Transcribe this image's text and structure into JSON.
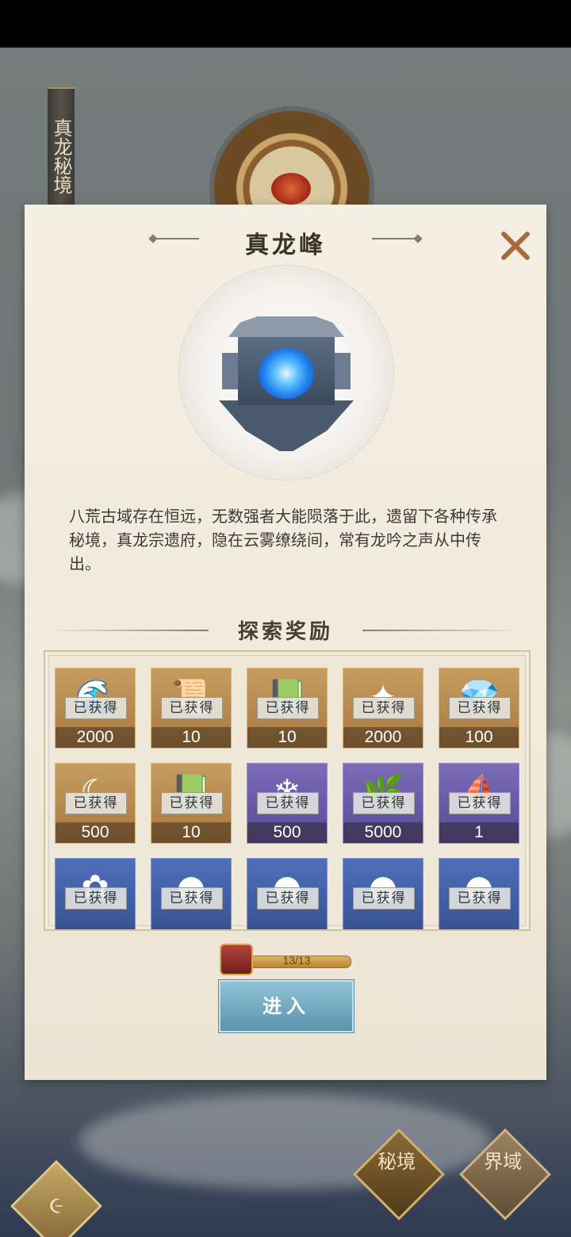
{
  "background": {
    "vertical_title": "真龙秘境"
  },
  "panel": {
    "title": "真龙峰",
    "description": "八荒古域存在恒远，无数强者大能陨落于此，遗留下各种传承秘境，真龙宗遗府，隐在云雾缭绕间，常有龙吟之声从中传出。",
    "rewards_heading": "探索奖励",
    "obtained_label": "已获得",
    "rewards": [
      {
        "icon": "blue-wave-icon",
        "glyph": "🌊",
        "qty": "2000",
        "tier": "gold"
      },
      {
        "icon": "scroll-icon",
        "glyph": "📜",
        "qty": "10",
        "tier": "gold"
      },
      {
        "icon": "book-icon",
        "glyph": "📗",
        "qty": "10",
        "tier": "gold"
      },
      {
        "icon": "gold-star-icon",
        "glyph": "✦",
        "qty": "2000",
        "tier": "gold"
      },
      {
        "icon": "crystal-orb-icon",
        "glyph": "💎",
        "qty": "100",
        "tier": "gold"
      },
      {
        "icon": "moon-crescent-icon",
        "glyph": "☾",
        "qty": "500",
        "tier": "gold"
      },
      {
        "icon": "book-icon",
        "glyph": "📗",
        "qty": "10",
        "tier": "gold"
      },
      {
        "icon": "ice-lotus-icon",
        "glyph": "❄",
        "qty": "500",
        "tier": "purple"
      },
      {
        "icon": "green-flame-icon",
        "glyph": "🌿",
        "qty": "5000",
        "tier": "purple"
      },
      {
        "icon": "ship-icon",
        "glyph": "⛵",
        "qty": "1",
        "tier": "purple"
      },
      {
        "icon": "white-feather-icon",
        "glyph": "✿",
        "qty": "",
        "tier": "blue"
      },
      {
        "icon": "blue-orb-icon",
        "glyph": "●",
        "qty": "",
        "tier": "blue"
      },
      {
        "icon": "gold-orb-icon",
        "glyph": "●",
        "qty": "",
        "tier": "blue"
      },
      {
        "icon": "red-orb-icon",
        "glyph": "●",
        "qty": "",
        "tier": "blue"
      },
      {
        "icon": "blue-orb-icon",
        "glyph": "●",
        "qty": "",
        "tier": "blue"
      }
    ],
    "progress": {
      "text": "13/13",
      "current": 13,
      "total": 13
    },
    "enter_label": "进入"
  },
  "bottom_nav": {
    "secret_realm": "秘境",
    "realm": "界域"
  },
  "colors": {
    "panel_bg": "#f3eee2",
    "accent_gold": "#b98430",
    "enter_btn": "#6fa4bd",
    "close_x": "#a86a3a"
  }
}
